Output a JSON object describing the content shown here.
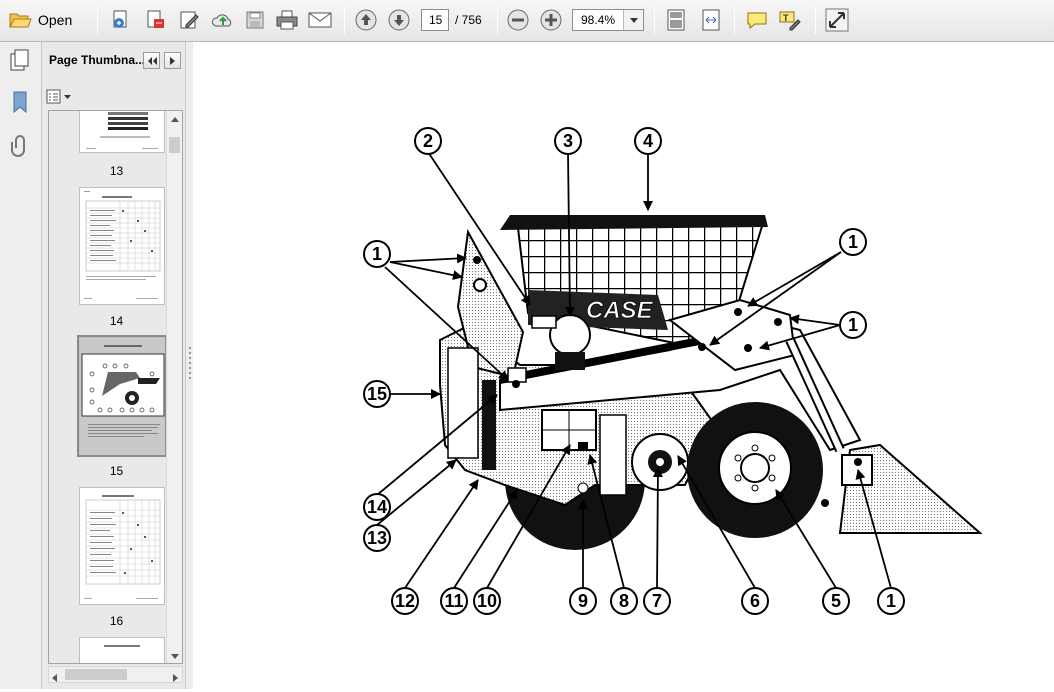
{
  "toolbar": {
    "open_label": "Open",
    "page_current": "15",
    "page_total": "/ 756",
    "zoom_value": "98.4%",
    "icons": [
      "folder-open-icon",
      "create-pdf-icon",
      "export-pdf-icon",
      "edit-icon",
      "upload-icon",
      "save-icon",
      "print-icon",
      "email-icon",
      "previous-page-icon",
      "next-page-icon",
      "zoom-out-icon",
      "zoom-in-icon",
      "fit-page-icon",
      "fit-width-icon",
      "comment-icon",
      "highlight-icon",
      "fullscreen-icon"
    ]
  },
  "sidebar": {
    "panel_title": "Page Thumbna...",
    "thumbnails": [
      {
        "label": "13"
      },
      {
        "label": "14"
      },
      {
        "label": "15"
      },
      {
        "label": "16"
      }
    ]
  },
  "diagram": {
    "brand_text": "CASE",
    "callouts": [
      "1",
      "2",
      "3",
      "4",
      "1",
      "1",
      "1",
      "15",
      "14",
      "13",
      "12",
      "11",
      "10",
      "9",
      "8",
      "7",
      "6",
      "5",
      "1"
    ]
  }
}
